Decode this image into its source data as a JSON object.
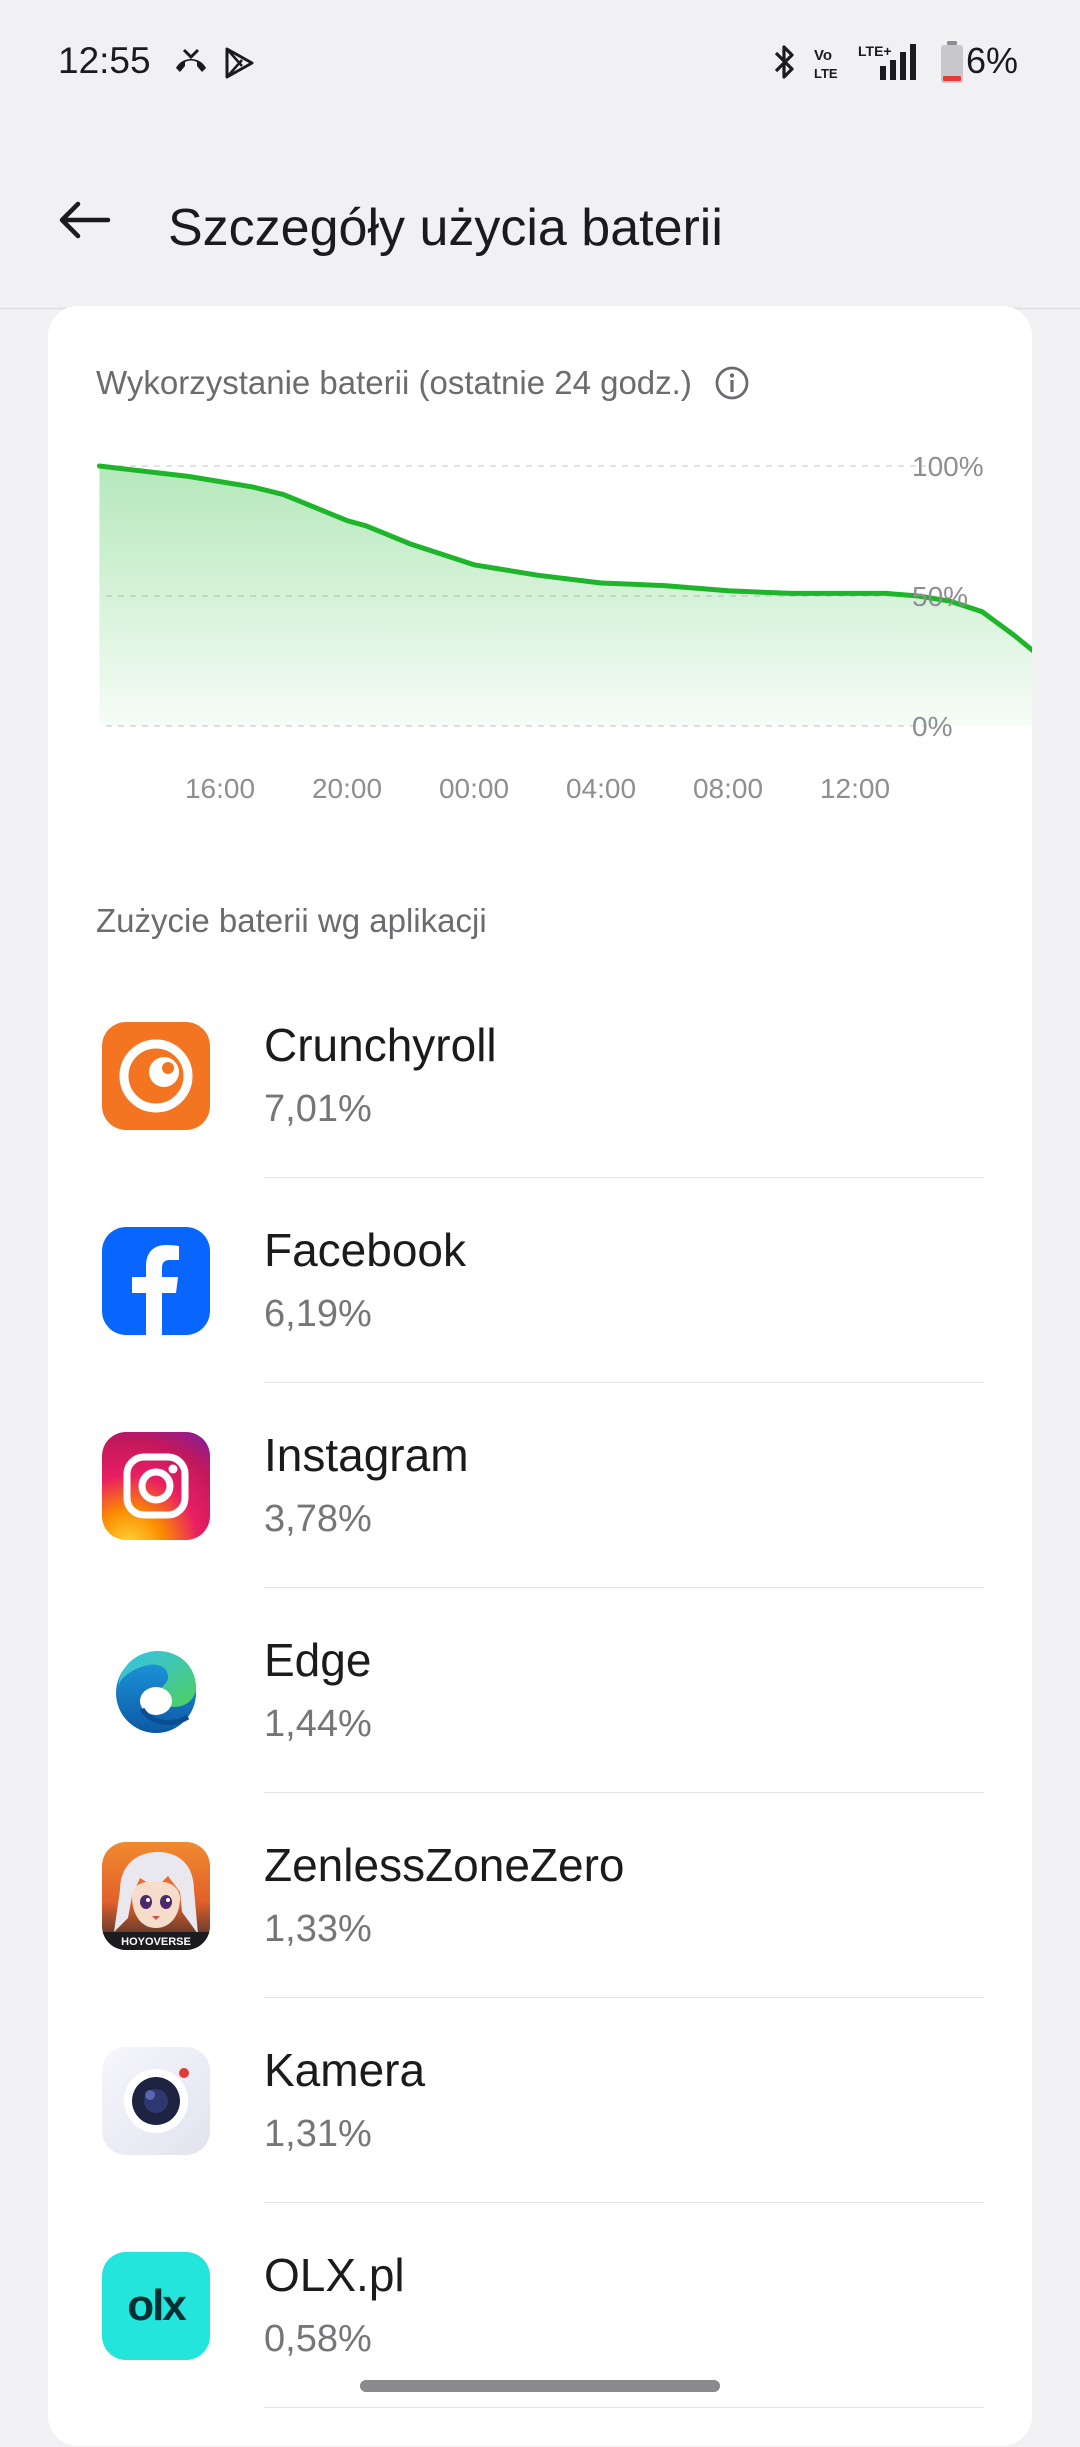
{
  "status_bar": {
    "time": "12:55",
    "battery_percent": "6%",
    "signal_label": "LTE+",
    "volte_label": "Vo LTE"
  },
  "header": {
    "title": "Szczegóły użycia baterii"
  },
  "chart_section": {
    "title": "Wykorzystanie baterii (ostatnie 24 godz.)"
  },
  "chart_data": {
    "type": "area",
    "title": "Wykorzystanie baterii (ostatnie 24 godz.)",
    "x_tick_labels": [
      "16:00",
      "20:00",
      "00:00",
      "04:00",
      "08:00",
      "12:00"
    ],
    "y_tick_labels": [
      "100%",
      "50%",
      "0%"
    ],
    "ylim": [
      0,
      100
    ],
    "grid": true,
    "color": "#1fb52b",
    "x_hours_from_first_tick": [
      -3.8,
      -1,
      0,
      1,
      2,
      3,
      4,
      4.6,
      6,
      8,
      9,
      10,
      12,
      14,
      16,
      18,
      20,
      21,
      22,
      23,
      24,
      25,
      26,
      26.8
    ],
    "values": [
      100,
      96,
      94,
      92,
      89,
      84,
      79,
      77,
      70,
      62,
      60,
      58,
      55,
      54,
      52,
      51,
      51,
      51,
      50,
      48,
      44,
      35,
      25,
      10
    ],
    "current_value": 10
  },
  "apps_section": {
    "label": "Zużycie baterii wg aplikacji",
    "apps": [
      {
        "name": "Crunchyroll",
        "usage": "7,01%",
        "icon": "crunchyroll-icon"
      },
      {
        "name": "Facebook",
        "usage": "6,19%",
        "icon": "facebook-icon"
      },
      {
        "name": "Instagram",
        "usage": "3,78%",
        "icon": "instagram-icon"
      },
      {
        "name": "Edge",
        "usage": "1,44%",
        "icon": "edge-icon"
      },
      {
        "name": "ZenlessZoneZero",
        "usage": "1,33%",
        "icon": "zenless-zone-zero-icon",
        "icon_text": "HOYOVERSE"
      },
      {
        "name": "Kamera",
        "usage": "1,31%",
        "icon": "camera-icon"
      },
      {
        "name": "OLX.pl",
        "usage": "0,58%",
        "icon": "olx-icon",
        "icon_text": "olx"
      }
    ]
  }
}
